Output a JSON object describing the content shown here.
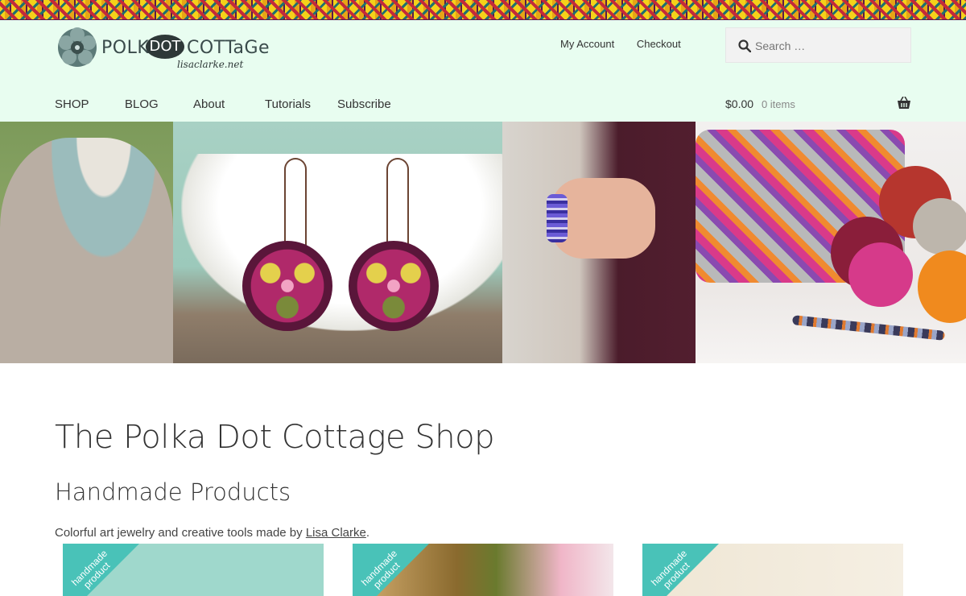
{
  "brand": {
    "name_part1": "POLKA",
    "name_part2": "DOT",
    "name_part3": "COTTaGe",
    "tagline": "lisaclarke.net"
  },
  "top_links": [
    "My Account",
    "Checkout"
  ],
  "search": {
    "placeholder": "Search …"
  },
  "nav": [
    "SHOP",
    "BLOG",
    "About",
    "Tutorials",
    "Subscribe"
  ],
  "cart": {
    "amount": "$0.00",
    "items": "0 items"
  },
  "content": {
    "title": "The Polka Dot Cottage Shop",
    "subtitle": "Handmade Products",
    "intro_text": "Colorful art jewelry and creative tools made by ",
    "intro_link": "Lisa Clarke",
    "intro_end": "."
  },
  "products": [
    {
      "badge": "handmade product"
    },
    {
      "badge": "handmade product"
    },
    {
      "badge": "handmade product"
    }
  ],
  "colors": {
    "header_bg": "#e8fdf0",
    "badge_teal": "#49c2b8"
  }
}
